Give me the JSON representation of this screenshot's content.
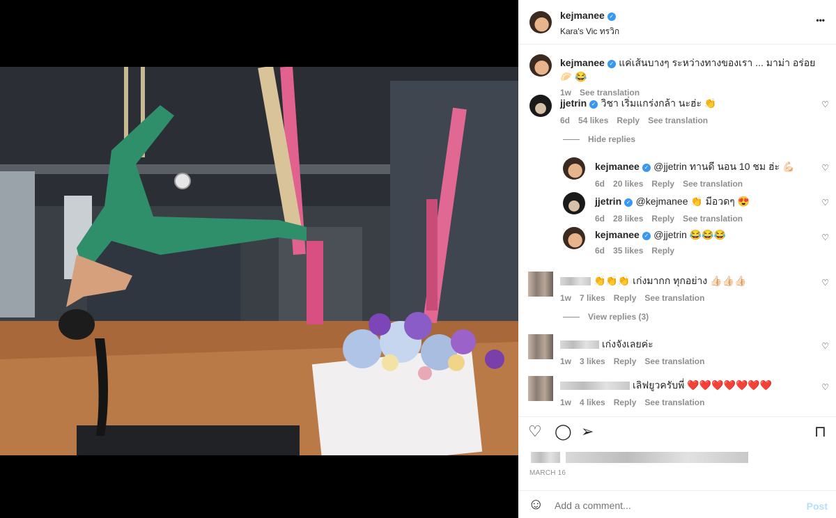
{
  "post": {
    "username": "kejmanee",
    "location": "Kara's Vic ทรวิก",
    "more": "•••"
  },
  "caption": {
    "username": "kejmanee",
    "text": "แค่เส้นบางๆ ระหว่างทางของเรา ... มาม่า อร่อย 🥟 😂",
    "time": "1w",
    "translate": "See translation"
  },
  "comments": [
    {
      "username": "jjetrin",
      "text": "วิชา เริ่มแกร่งกล้า นะฮ่ะ 👏",
      "time": "6d",
      "likes": "54 likes",
      "reply": "Reply",
      "translate": "See translation"
    },
    {
      "username": "kejmanee",
      "text": "@jjetrin ทานดี นอน 10 ชม ฮ่ะ 💪🏻",
      "time": "6d",
      "likes": "20 likes",
      "reply": "Reply",
      "translate": "See translation"
    },
    {
      "username": "jjetrin",
      "text": "@kejmanee 👏 มีอวดๆ 😍",
      "time": "6d",
      "likes": "28 likes",
      "reply": "Reply",
      "translate": "See translation"
    },
    {
      "username": "kejmanee",
      "text": "@jjetrin 😂😂😂",
      "time": "6d",
      "likes": "35 likes",
      "reply": "Reply"
    },
    {
      "text": "👏👏👏 เก่งมากก ทุกอย่าง 👍🏻👍🏻👍🏻",
      "time": "1w",
      "likes": "7 likes",
      "reply": "Reply",
      "translate": "See translation"
    },
    {
      "text": "เก่งจังเลยค่ะ",
      "time": "1w",
      "likes": "3 likes",
      "reply": "Reply",
      "translate": "See translation"
    },
    {
      "text": "เลิฟยูวครับพี่ ❤️❤️❤️❤️❤️❤️❤️",
      "time": "1w",
      "likes": "4 likes",
      "reply": "Reply",
      "translate": "See translation"
    }
  ],
  "replies": {
    "hide": "Hide replies",
    "view": "View replies (3)"
  },
  "footer": {
    "date": "MARCH 16",
    "add_comment_placeholder": "Add a comment...",
    "post_button": "Post"
  },
  "icons": {
    "heart": "♡",
    "comment": "◯",
    "share": "➢",
    "bookmark": "⊓",
    "emoji": "☺",
    "verified": "✓"
  },
  "colors": {
    "verified": "#3897f0",
    "post_button": "#b2dffc"
  }
}
